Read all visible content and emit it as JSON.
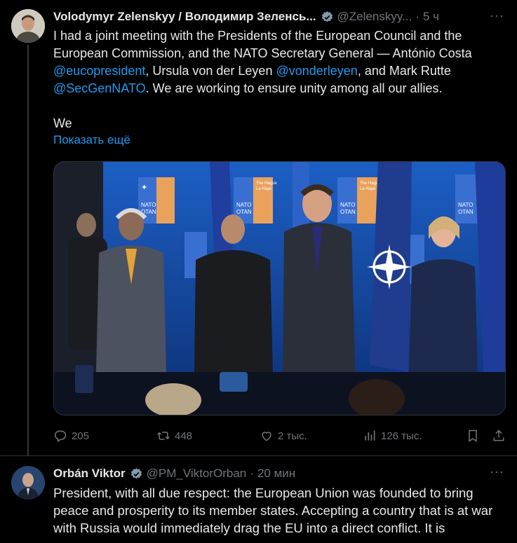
{
  "tweets": [
    {
      "author_name": "Volodymyr Zelenskyy / Володимир Зеленсь...",
      "handle": "@Zelenskyy...",
      "time": "5 ч",
      "text_parts": [
        "I had a joint meeting with the Presidents of the European Council and the European Commission, and the NATO Secretary General — António Costa ",
        "@eucopresident",
        ", Ursula von der Leyen ",
        "@vonderleyen",
        ", and Mark Rutte ",
        "@SecGenNATO",
        ". We are working to ensure unity among all our allies."
      ],
      "text_more": "We",
      "show_more": "Показать ещё",
      "media": {
        "backdrop_label_1": "NATO",
        "backdrop_label_2": "OTAN",
        "sign_text_1": "The Hague",
        "sign_text_2": "La Haye"
      },
      "stats": {
        "replies": "205",
        "reposts": "448",
        "likes": "2 тыс.",
        "views": "126 тыс."
      }
    },
    {
      "author_name": "Orbán Viktor",
      "handle": "@PM_ViktorOrban",
      "time": "20 мин",
      "text": "President, with all due respect: the European Union was founded to bring peace and prosperity to its member states. Accepting a country that is at war with Russia would immediately drag the EU into a direct conflict. It is"
    }
  ],
  "colors": {
    "background": "#000000",
    "text": "#e7e9ea",
    "secondary": "#71767b",
    "link": "#1d9bf0",
    "verified": "#829aab"
  },
  "icons": [
    "verified-badge-icon",
    "more-icon",
    "reply-icon",
    "repost-icon",
    "like-icon",
    "views-icon",
    "bookmark-icon",
    "share-icon"
  ]
}
